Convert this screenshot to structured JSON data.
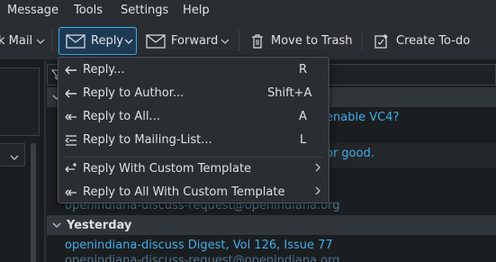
{
  "menubar": {
    "items": [
      "Message",
      "Tools",
      "Settings",
      "Help"
    ]
  },
  "toolbar": {
    "check_mail_label": "k Mail",
    "reply_label": "Reply",
    "forward_label": "Forward",
    "move_to_trash_label": "Move to Trash",
    "create_todo_label": "Create To-do"
  },
  "reply_menu": {
    "items": [
      {
        "label": "Reply...",
        "shortcut": "R",
        "icon": "reply-icon"
      },
      {
        "label": "Reply to Author...",
        "shortcut": "Shift+A",
        "icon": "reply-icon"
      },
      {
        "label": "Reply to All...",
        "shortcut": "A",
        "icon": "reply-all-icon"
      },
      {
        "label": "Reply to Mailing-List...",
        "shortcut": "L",
        "icon": "mailing-list-reply-icon"
      },
      {
        "label": "Reply With Custom Template",
        "shortcut": "",
        "icon": "reply-template-icon"
      },
      {
        "label": "Reply to All With Custom Template",
        "shortcut": "",
        "icon": "reply-all-icon"
      }
    ]
  },
  "message_list": {
    "visible_fragments": {
      "frag1": "enable VC4?",
      "frag2": "or good."
    },
    "rows_before": {
      "sender1": "openindiana-discuss-request@openindiana.org"
    },
    "groups": [
      {
        "label": "Yesterday"
      }
    ],
    "rows_after": {
      "subject1": "openindiana-discuss Digest, Vol 126, Issue 77",
      "sender1": "openindiana-discuss-request@openindiana.org"
    }
  },
  "colors": {
    "accent": "#3daee9",
    "background": "#232629",
    "menu_bg": "#2a2e32"
  }
}
